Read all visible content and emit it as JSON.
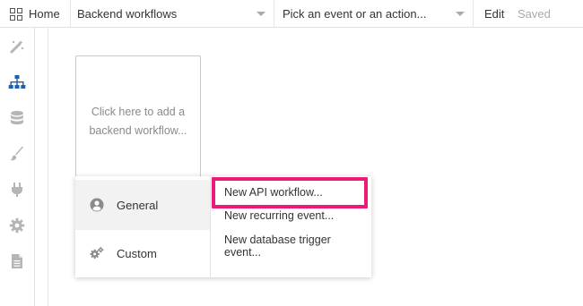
{
  "topbar": {
    "home_label": "Home",
    "page_select": "Backend workflows",
    "event_select": "Pick an event or an action...",
    "edit_label": "Edit",
    "saved_label": "Saved"
  },
  "sidebar": {
    "items": [
      {
        "icon": "design-icon",
        "active": false
      },
      {
        "icon": "workflow-icon",
        "active": true
      },
      {
        "icon": "database-icon",
        "active": false
      },
      {
        "icon": "styles-brush-icon",
        "active": false
      },
      {
        "icon": "plugins-icon",
        "active": false
      },
      {
        "icon": "settings-gear-icon",
        "active": false
      },
      {
        "icon": "logs-document-icon",
        "active": false
      }
    ]
  },
  "canvas": {
    "add_workflow_text": "Click here to add a backend workflow..."
  },
  "popup": {
    "categories": [
      {
        "label": "General",
        "icon": "user-circle-icon",
        "selected": true
      },
      {
        "label": "Custom",
        "icon": "gears-icon",
        "selected": false
      }
    ],
    "options": [
      "New API workflow...",
      "New recurring event...",
      "New database trigger event..."
    ]
  },
  "colors": {
    "accent_blue": "#1a5fb4",
    "highlight_pink": "#ec1a7a",
    "icon_gray": "#b5b5b5"
  }
}
